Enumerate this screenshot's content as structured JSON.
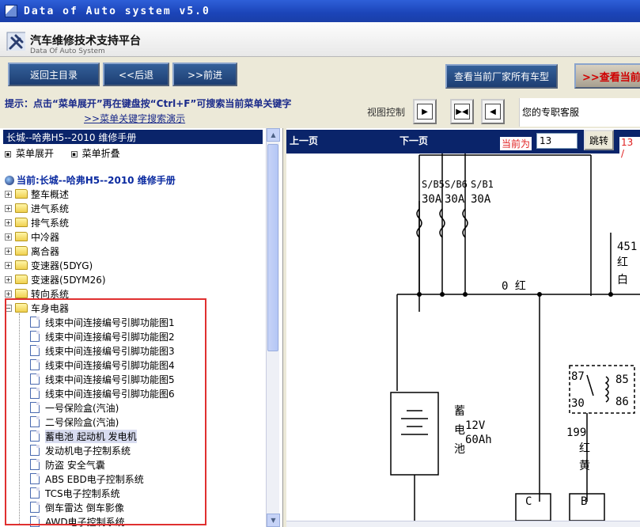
{
  "window": {
    "title": "Data of Auto system v5.0"
  },
  "header": {
    "title_cn": "汽车维修技术支持平台",
    "title_en": "Data Of Auto System"
  },
  "nav": {
    "home": "返回主目录",
    "back": "<<后退",
    "forward": ">>前进",
    "all_models": "查看当前厂家所有车型",
    "view_current": ">>查看当前"
  },
  "hint": {
    "text": "提示：点击“菜单展开”再在键盘按“Ctrl+F”可搜索当前菜单关键字",
    "link": ">>菜单关键字搜索演示"
  },
  "view_control": {
    "label": "视图控制"
  },
  "service": {
    "text": "您的专职客服"
  },
  "tree": {
    "manual_title": "长城--哈弗H5--2010 维修手册",
    "expand": "菜单展开",
    "collapse": "菜单折叠",
    "current": "当前:长城--哈弗H5--2010 维修手册",
    "folders": [
      "整车概述",
      "进气系统",
      "排气系统",
      "中冷器",
      "离合器",
      "变速器(5DYG)",
      "变速器(5DYM26)",
      "转向系统",
      "车身电器"
    ],
    "docs": [
      "线束中间连接编号引脚功能图1",
      "线束中间连接编号引脚功能图2",
      "线束中间连接编号引脚功能图3",
      "线束中间连接编号引脚功能图4",
      "线束中间连接编号引脚功能图5",
      "线束中间连接编号引脚功能图6",
      "一号保险盒(汽油)",
      "二号保险盒(汽油)",
      "蓄电池  起动机  发电机",
      "发动机电子控制系统",
      "防盗  安全气囊",
      "ABS EBD电子控制系统",
      "TCS电子控制系统",
      "倒车雷达  倒车影像",
      "AWD电子控制系统"
    ]
  },
  "pager": {
    "prev": "上一页",
    "next": "下一页",
    "current_label": "当前为",
    "current_value": "13",
    "jump": "跳转",
    "total": "13 /"
  },
  "diagram": {
    "fuse1": "S/B5",
    "fuse2": "S/B6",
    "fuse3": "S/B1",
    "amp1": "30A",
    "amp2": "30A",
    "amp3": "30A",
    "wire_0": "0 红",
    "wire_451": "451",
    "wire_451_c1": "红",
    "wire_451_c2": "白",
    "battery_c1": "蓄",
    "battery_c2": "电",
    "battery_c3": "池",
    "battery_v": "12V",
    "battery_ah": "60Ah",
    "relay_87": "87",
    "relay_30": "30",
    "relay_85": "85",
    "relay_86": "86",
    "wire_199": "199",
    "wire_199_c1": "红",
    "wire_199_c2": "黄",
    "term_c": "C",
    "term_b": "B"
  }
}
